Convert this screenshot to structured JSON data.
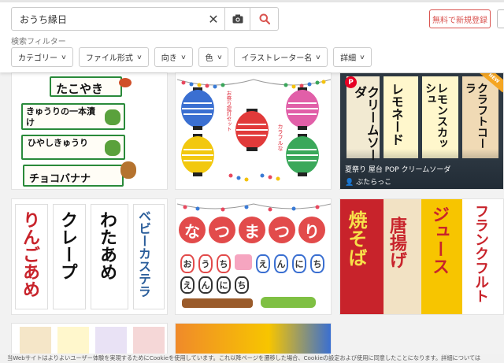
{
  "search": {
    "query": "おうち縁日"
  },
  "header": {
    "register_label": "無料で新規登録"
  },
  "filters": {
    "title": "検索フィルター",
    "items": [
      {
        "label": "カテゴリー"
      },
      {
        "label": "ファイル形式"
      },
      {
        "label": "向き"
      },
      {
        "label": "色"
      },
      {
        "label": "イラストレーター名"
      },
      {
        "label": "詳細"
      }
    ]
  },
  "tiles": {
    "t1": {
      "labels": [
        "たこやき",
        "きゅうりの一本漬け",
        "ひやしきゅうり",
        "チョコバナナ"
      ]
    },
    "t2": {
      "caption_left": "お祭り提灯セット",
      "caption_right": "カラフルな"
    },
    "t3": {
      "signs": [
        "クリームソーダ",
        "レモネード",
        "レモンスカッシュ",
        "クラフトコーラ"
      ],
      "title": "夏祭り 屋台 POP クリームソーダ",
      "author": "ぶたらっこ",
      "badge": "NEW",
      "pin": "P"
    },
    "t4": {
      "banners": [
        "りんごあめ",
        "クレープ",
        "わたあめ",
        "ベビーカステラ"
      ]
    },
    "t5": {
      "big": [
        "な",
        "つ",
        "ま",
        "つ",
        "り"
      ],
      "row1": [
        "お",
        "う",
        "ち",
        "え",
        "ん",
        "に",
        "ち"
      ],
      "row2": [
        "え",
        "ん",
        "に",
        "ち"
      ]
    },
    "t6": {
      "banners": [
        "焼そば",
        "唐揚げ",
        "ジュース",
        "フランクフルト"
      ]
    }
  },
  "cookie": {
    "text": "当Webサイトはよりよいユーザー体験を実現するためにCookieを使用しています。これ以降ページを遷移した場合、Cookieの設定および使用に同意したことになります。詳細については"
  },
  "colors": {
    "accent": "#d9534f",
    "card_green": "#2a8a3a",
    "pin": "#e60023"
  }
}
